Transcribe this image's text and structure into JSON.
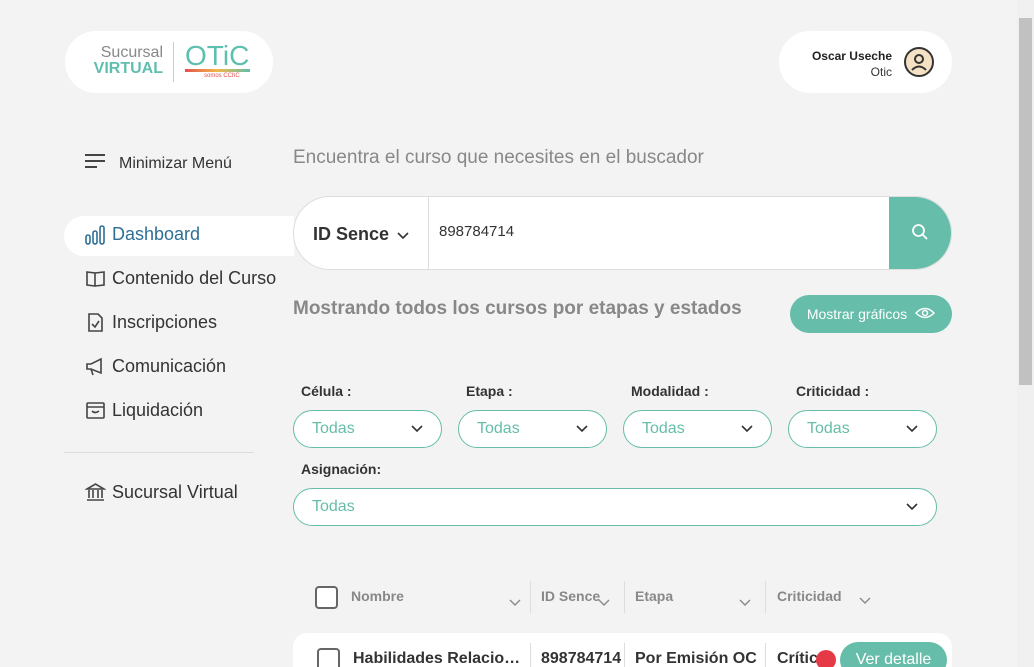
{
  "brand": {
    "sucursal": "Sucursal",
    "virtual": "VIRTUAL",
    "otic": "OTiC",
    "sub": "somos CChC"
  },
  "user": {
    "name": "Oscar Useche",
    "org": "Otic"
  },
  "menu": {
    "minimize_label": "Minimizar Menú",
    "items": [
      {
        "label": "Dashboard",
        "icon": "chart-bars-icon",
        "active": true
      },
      {
        "label": "Contenido del Curso",
        "icon": "open-book-icon"
      },
      {
        "label": "Inscripciones",
        "icon": "document-check-icon"
      },
      {
        "label": "Comunicación",
        "icon": "megaphone-icon"
      },
      {
        "label": "Liquidación",
        "icon": "archive-box-icon"
      }
    ],
    "bottom_item": {
      "label": "Sucursal Virtual",
      "icon": "bank-icon"
    }
  },
  "search": {
    "title": "Encuentra el curso que necesites en el buscador",
    "type_label": "ID Sence",
    "value": "898784714"
  },
  "results": {
    "subtitle": "Mostrando todos los cursos por etapas y estados",
    "show_charts_label": "Mostrar gráficos"
  },
  "filters": {
    "celula": {
      "label": "Célula :",
      "value": "Todas"
    },
    "etapa": {
      "label": "Etapa :",
      "value": "Todas"
    },
    "modalidad": {
      "label": "Modalidad :",
      "value": "Todas"
    },
    "criticidad": {
      "label": "Criticidad :",
      "value": "Todas"
    },
    "asignacion": {
      "label": "Asignación:",
      "value": "Todas"
    }
  },
  "table": {
    "headers": [
      "Nombre",
      "ID Sence",
      "Etapa",
      "Criticidad"
    ],
    "rows": [
      {
        "nombre": "Habilidades Relaciona...",
        "id_sence": "898784714",
        "etapa": "Por Emisión OC",
        "criticidad": "Crític",
        "action": "Ver detalle"
      }
    ]
  },
  "colors": {
    "accent": "#66bda9",
    "active_nav": "#2f6f94",
    "critical": "#e63946"
  }
}
